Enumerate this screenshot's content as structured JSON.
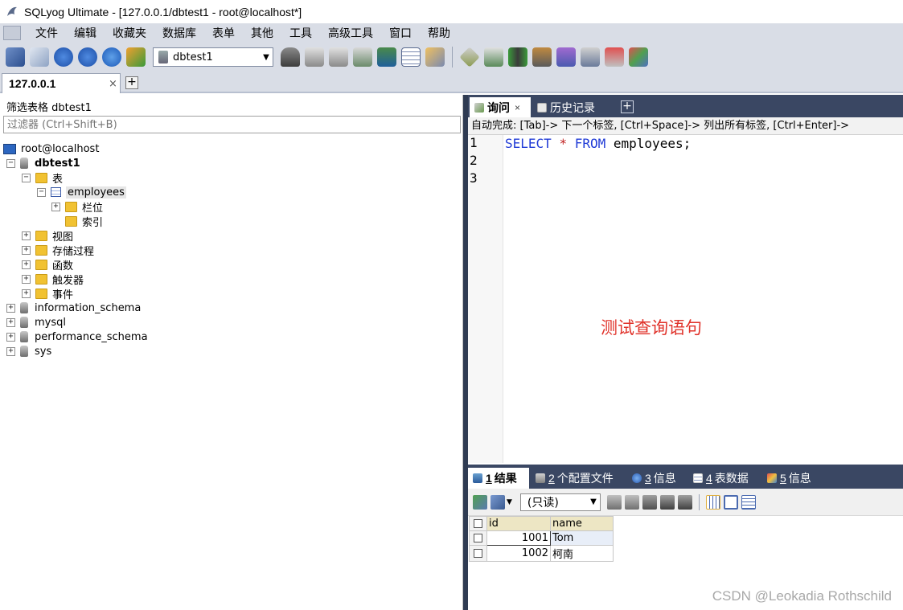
{
  "window": {
    "title": "SQLyog Ultimate - [127.0.0.1/dbtest1 - root@localhost*]"
  },
  "menu": {
    "items": [
      "文件",
      "编辑",
      "收藏夹",
      "数据库",
      "表单",
      "其他",
      "工具",
      "高级工具",
      "窗口",
      "帮助"
    ]
  },
  "toolbar": {
    "db_select_value": "dbtest1"
  },
  "connection_tab": {
    "label": "127.0.0.1",
    "close": "×",
    "add": "+"
  },
  "object_browser": {
    "filter_label": "筛选表格 dbtest1",
    "filter_placeholder": "过滤器 (Ctrl+Shift+B)",
    "tree": {
      "server": "root@localhost",
      "database": "dbtest1",
      "tables_folder": "表",
      "table": "employees",
      "columns_folder": "栏位",
      "indexes_folder": "索引",
      "views_folder": "视图",
      "procedures_folder": "存储过程",
      "functions_folder": "函数",
      "triggers_folder": "触发器",
      "events_folder": "事件",
      "other_dbs": [
        "information_schema",
        "mysql",
        "performance_schema",
        "sys"
      ]
    }
  },
  "query_tabs": {
    "query_label": "询问",
    "history_label": "历史记录",
    "close": "×",
    "add": "+"
  },
  "autocomplete_hint": "自动完成: [Tab]-> 下一个标签, [Ctrl+Space]-> 列出所有标签, [Ctrl+Enter]->",
  "editor": {
    "line_numbers": [
      "1",
      "2",
      "3"
    ],
    "code": {
      "select": "SELECT",
      "star": "*",
      "from": "FROM",
      "table": "employees;"
    },
    "annotation": "测试查询语句"
  },
  "result_tabs": [
    {
      "num": "1",
      "label": "结果"
    },
    {
      "num": "2",
      "label": "个配置文件"
    },
    {
      "num": "3",
      "label": "信息"
    },
    {
      "num": "4",
      "label": "表数据"
    },
    {
      "num": "5",
      "label": "信息"
    }
  ],
  "result_toolbar": {
    "mode_select": "(只读)"
  },
  "result_grid": {
    "columns": [
      "id",
      "name"
    ],
    "rows": [
      {
        "id": "1001",
        "name": "Tom"
      },
      {
        "id": "1002",
        "name": "柯南"
      }
    ]
  },
  "watermark": "CSDN @Leokadia Rothschild",
  "colors": {
    "dark_panel": "#3a4763",
    "keyword": "#1f3ad6",
    "annotation": "#e0322a"
  }
}
